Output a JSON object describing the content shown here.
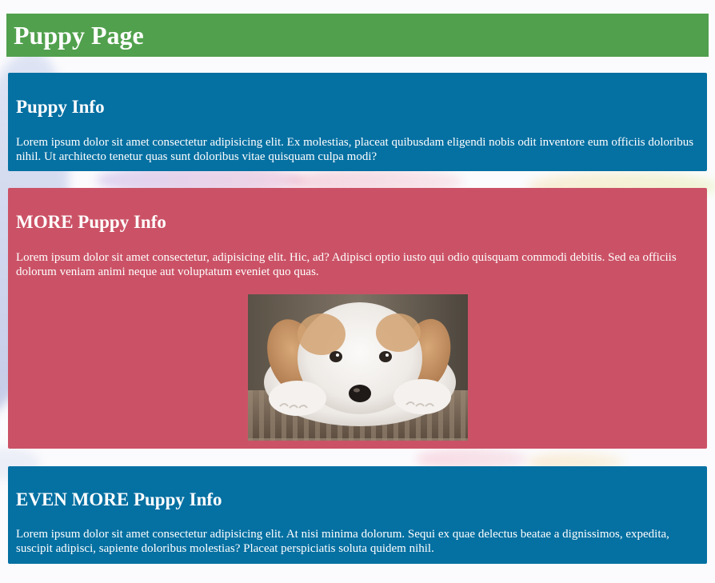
{
  "header": {
    "title": "Puppy Page",
    "color": "#51a04d"
  },
  "sections": [
    {
      "title": "Puppy Info",
      "text": "Lorem ipsum dolor sit amet consectetur adipisicing elit. Ex molestias, placeat quibusdam eligendi nobis odit inventore eum officiis doloribus nihil. Ut architecto tenetur quas sunt doloribus vitae quisquam culpa modi?",
      "color": "#0570a2"
    },
    {
      "title": "MORE Puppy Info",
      "text": "Lorem ipsum dolor sit amet consectetur, adipisicing elit. Hic, ad? Adipisci optio iusto qui odio quisquam commodi debitis. Sed ea officiis dolorum veniam animi neque aut voluptatum eveniet quo quas.",
      "color": "#cb5266",
      "image": "puppy-photo"
    },
    {
      "title": "EVEN MORE Puppy Info",
      "text": "Lorem ipsum dolor sit amet consectetur adipisicing elit. At nisi minima dolorum. Sequi ex quae delectus beatae a dignissimos, expedita, suscipit adipisci, sapiente doloribus molestias? Placeat perspiciatis soluta quidem nihil.",
      "color": "#0570a2"
    }
  ]
}
